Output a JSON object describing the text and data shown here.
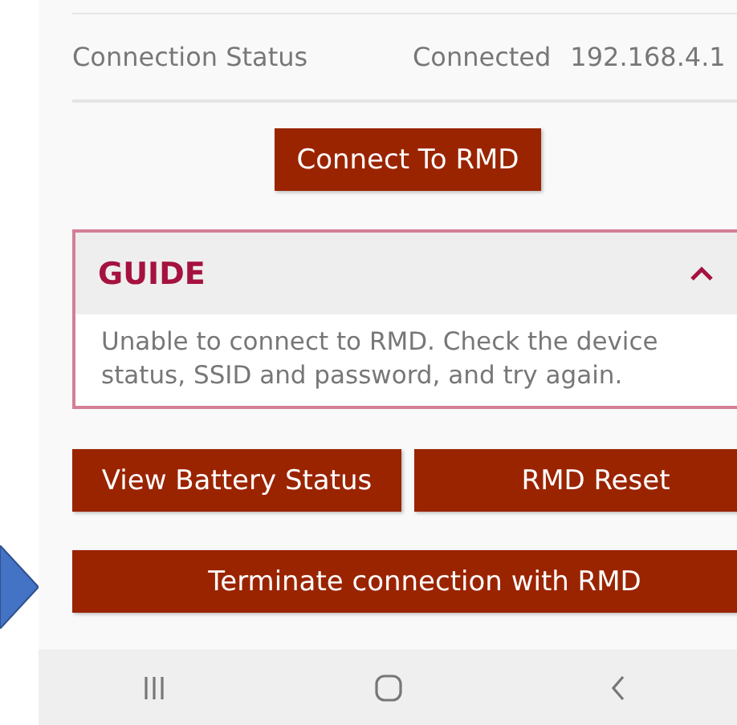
{
  "status_row": {
    "label": "Connection Status",
    "status": "Connected",
    "address": "192.168.4.1"
  },
  "connect_button": "Connect To RMD",
  "guide": {
    "title": "GUIDE",
    "expanded": true,
    "message": "Unable to connect to RMD. Check the device status, SSID and password, and try again."
  },
  "action_buttons": [
    "View Battery Status",
    "RMD Reset"
  ],
  "terminate_button": "Terminate connection with RMD",
  "nav_bar": [
    {
      "kind": "recents"
    },
    {
      "kind": "home"
    },
    {
      "kind": "back"
    }
  ]
}
